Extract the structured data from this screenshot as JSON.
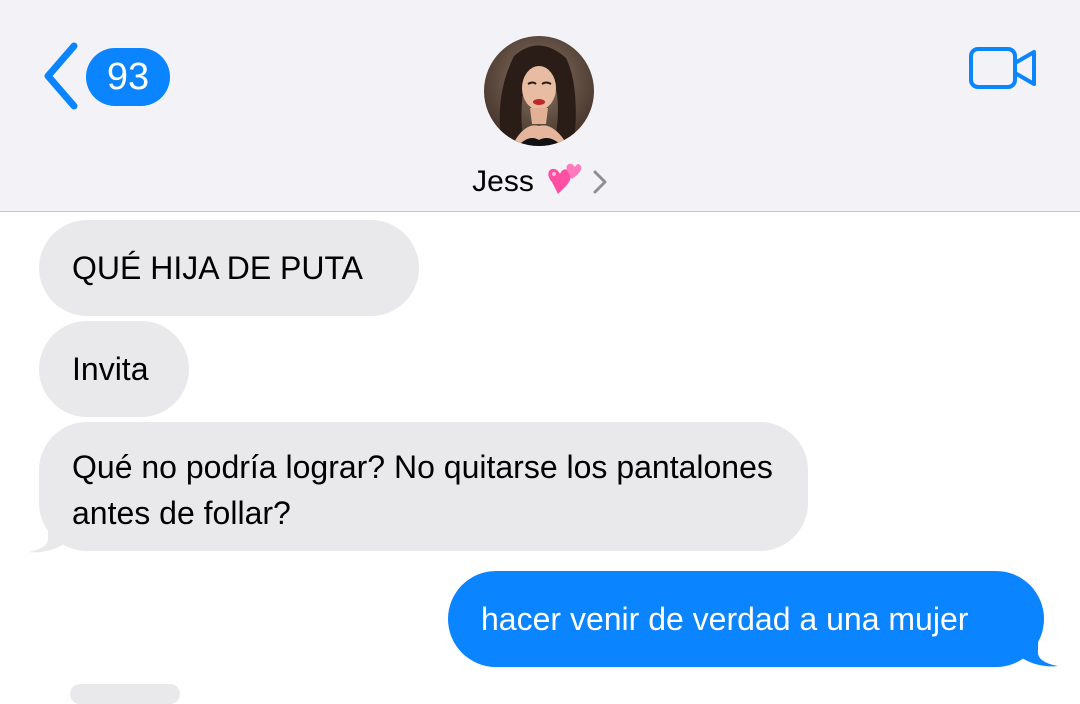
{
  "header": {
    "unread_count": "93",
    "contact_name": "Jess",
    "contact_emoji": "two-hearts-emoji",
    "accent_color": "#0a84ff",
    "background_color": "#f2f2f7"
  },
  "messages": [
    {
      "direction": "incoming",
      "text": "QUÉ HIJA DE PUTA"
    },
    {
      "direction": "incoming",
      "text": "Invita"
    },
    {
      "direction": "incoming",
      "text": "Qué no podría lograr? No quitarse los pantalones antes de follar?"
    },
    {
      "direction": "outgoing",
      "text": "hacer venir de verdad a una mujer"
    }
  ],
  "colors": {
    "incoming_bubble": "#e9e9eb",
    "outgoing_bubble": "#0a84ff"
  },
  "icons": {
    "back": "chevron-left-icon",
    "video": "video-camera-icon",
    "disclosure": "chevron-right-icon"
  }
}
